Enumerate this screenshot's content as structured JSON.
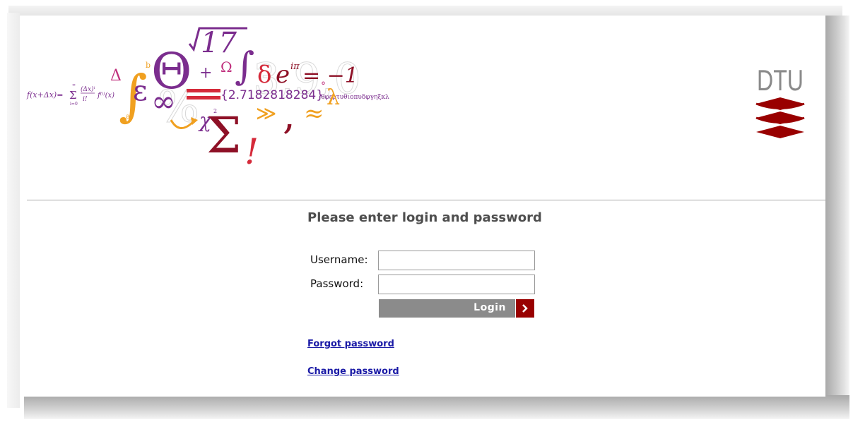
{
  "banner": {
    "math_fragments": {
      "formula": "f(x+Δx)=",
      "sum_top": "∞",
      "sum_bottom": "i=0",
      "fraction_num": "(Δx)ⁱ",
      "fraction_den": "i!",
      "derivative": "f⁽ⁱ⁾(x)",
      "delta": "Δ",
      "integral_b": "b",
      "integral_a": "a",
      "epsilon": "ε",
      "theta": "Θ",
      "plus": "+",
      "sqrt_value": "17",
      "omega": "Ω",
      "small_delta": "δ",
      "e_power": "e",
      "i_pi": "iπ",
      "equals_minus_one": "= −1",
      "infinity": "∞",
      "euler": "{2.7182818284}",
      "greek_string": "θφερτυθιοπυδφγηξκλ",
      "chi": "χ",
      "chi_exp": "2",
      "sigma": "Σ",
      "exclaim": "!",
      "much_greater": "≫",
      "comma": ",",
      "approx": "≈",
      "lambda": "λ",
      "degree": "°",
      "ghost_percent": "%",
      "ghost_numbers": "3,9,0"
    },
    "logo_text": "DTU"
  },
  "login": {
    "title": "Please enter login and password",
    "username_label": "Username:",
    "username_value": "",
    "password_label": "Password:",
    "password_value": "",
    "button_label": "Login",
    "forgot_password": "Forgot password",
    "change_password": "Change password"
  },
  "icons": {
    "login_arrow": "chevron-right-icon",
    "logo": "dtu-logo-icon"
  },
  "colors": {
    "dtu_red": "#990000",
    "button_gray": "#8b8b8b",
    "link_blue": "#1a1aa6",
    "title_gray": "#4e4e4e",
    "purple": "#7b2d8e",
    "magenta": "#c0307d",
    "orange": "#f0a020",
    "crimson": "#d52a3a",
    "dark_red": "#8e1026"
  }
}
